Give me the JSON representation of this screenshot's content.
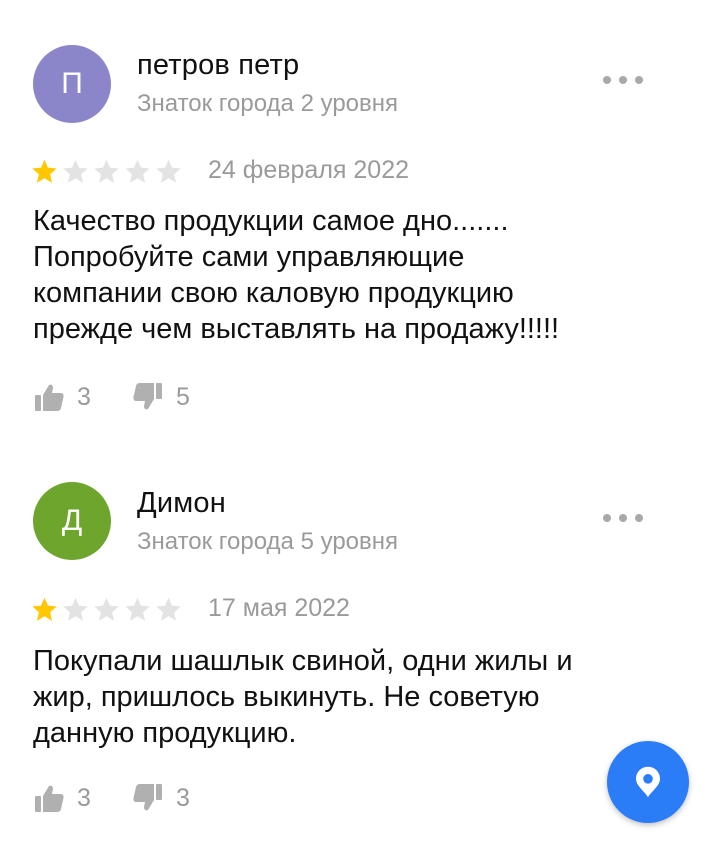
{
  "reviews": [
    {
      "avatar_letter": "П",
      "avatar_color": "#8b86c9",
      "author": "петров петр",
      "level": "Знаток города 2 уровня",
      "rating": 1,
      "rating_max": 5,
      "date": "24 февраля 2022",
      "text": "Качество продукции самое дно.......\nПопробуйте сами управляющие\nкомпании свою каловую продукцию\nпрежде чем выставлять на продажу!!!!!",
      "likes": "3",
      "dislikes": "5"
    },
    {
      "avatar_letter": "Д",
      "avatar_color": "#6ea52d",
      "author": "Димон",
      "level": "Знаток города 5 уровня",
      "rating": 1,
      "rating_max": 5,
      "date": "17 мая 2022",
      "text": "Покупали шашлык свиной, одни жилы и\nжир, пришлось выкинуть. Не советую\nданную продукцию.",
      "likes": "3",
      "dislikes": "3"
    }
  ],
  "colors": {
    "star_filled": "#ffc700",
    "star_empty": "#e3e3e3",
    "fab": "#2b7cf7",
    "reaction_icon": "#b0b0b0"
  },
  "icons": {
    "more": "more-dots-icon",
    "like": "thumbs-up-icon",
    "dislike": "thumbs-down-icon",
    "fab": "map-pin-icon"
  }
}
